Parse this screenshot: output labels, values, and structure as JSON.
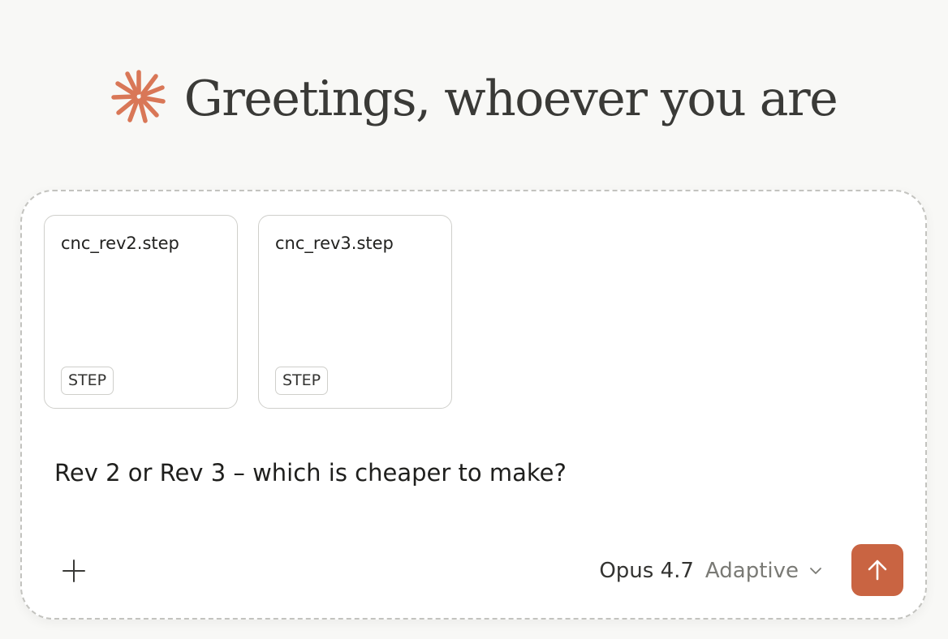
{
  "header": {
    "greeting": "Greetings, whoever you are",
    "logo_icon": "asterisk-burst-icon",
    "logo_color": "#d97757"
  },
  "composer": {
    "attachments": [
      {
        "name": "cnc_rev2.step",
        "type_badge": "STEP"
      },
      {
        "name": "cnc_rev3.step",
        "type_badge": "STEP"
      }
    ],
    "message": "Rev 2 or Rev 3 – which is cheaper to make?",
    "add_icon": "plus-icon",
    "model": {
      "name": "Opus 4.7",
      "mode": "Adaptive",
      "dropdown_icon": "chevron-down-icon"
    },
    "send": {
      "icon": "arrow-up-icon",
      "color": "#c96442"
    }
  }
}
